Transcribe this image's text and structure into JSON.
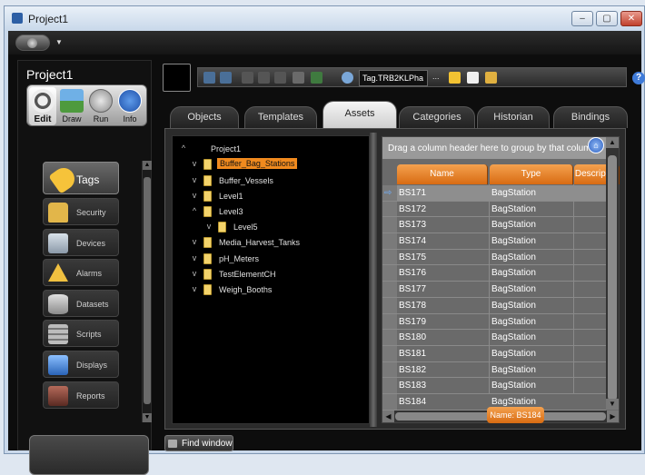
{
  "window": {
    "title": "Project1",
    "min_label": "–",
    "max_label": "▢",
    "close_label": "✕"
  },
  "project": {
    "title": "Project1"
  },
  "modes": [
    {
      "label": "Edit",
      "icon": "gear-icon"
    },
    {
      "label": "Draw",
      "icon": "picture-icon"
    },
    {
      "label": "Run",
      "icon": "play-icon"
    },
    {
      "label": "Info",
      "icon": "info-icon"
    }
  ],
  "nav": [
    {
      "label": "Tags",
      "icon": "tag-icon",
      "color": "#f6c33a"
    },
    {
      "label": "Security",
      "icon": "lock-icon",
      "color": "#e2b64a"
    },
    {
      "label": "Devices",
      "icon": "device-icon",
      "color": "#b9c4cf"
    },
    {
      "label": "Alarms",
      "icon": "warning-icon",
      "color": "#f0c040"
    },
    {
      "label": "Datasets",
      "icon": "database-icon",
      "color": "#c8c8c8"
    },
    {
      "label": "Scripts",
      "icon": "calculator-icon",
      "color": "#bcbcbc"
    },
    {
      "label": "Displays",
      "icon": "monitor-icon",
      "color": "#4a8ad8"
    },
    {
      "label": "Reports",
      "icon": "report-icon",
      "color": "#8a4a3a"
    }
  ],
  "toolbar": {
    "tag_field": "Tag.TRB2KLPha",
    "more_label": "...",
    "help_label": "?"
  },
  "tabs": [
    {
      "label": "Objects"
    },
    {
      "label": "Templates"
    },
    {
      "label": "Assets"
    },
    {
      "label": "Categories"
    },
    {
      "label": "Historian"
    },
    {
      "label": "Bindings"
    }
  ],
  "tree": {
    "root": {
      "label": "Project1",
      "expander": "^"
    },
    "items": [
      {
        "label": "Buffer_Bag_Stations",
        "expander": "v",
        "selected": true
      },
      {
        "label": "Buffer_Vessels",
        "expander": "v"
      },
      {
        "label": "Level1",
        "expander": "v"
      },
      {
        "label": "Level3",
        "expander": "^"
      },
      {
        "label": "Level5",
        "expander": "v"
      },
      {
        "label": "Media_Harvest_Tanks",
        "expander": "v"
      },
      {
        "label": "pH_Meters",
        "expander": "v"
      },
      {
        "label": "TestElementCH",
        "expander": "v"
      },
      {
        "label": "Weigh_Booths",
        "expander": "v"
      }
    ]
  },
  "grid": {
    "group_hint": "Drag a column header here to group by that column",
    "columns": [
      "Name",
      "Type",
      "Descripti..."
    ],
    "rows": [
      [
        "BS171",
        "BagStation",
        ""
      ],
      [
        "BS172",
        "BagStation",
        ""
      ],
      [
        "BS173",
        "BagStation",
        ""
      ],
      [
        "BS174",
        "BagStation",
        ""
      ],
      [
        "BS175",
        "BagStation",
        ""
      ],
      [
        "BS176",
        "BagStation",
        ""
      ],
      [
        "BS177",
        "BagStation",
        ""
      ],
      [
        "BS178",
        "BagStation",
        ""
      ],
      [
        "BS179",
        "BagStation",
        ""
      ],
      [
        "BS180",
        "BagStation",
        ""
      ],
      [
        "BS181",
        "BagStation",
        ""
      ],
      [
        "BS182",
        "BagStation",
        ""
      ],
      [
        "BS183",
        "BagStation",
        ""
      ],
      [
        "BS184",
        "BagStation",
        ""
      ]
    ],
    "tooltip": "Name: BS184",
    "current_row_marker": "⇨"
  },
  "find_window": {
    "label": "Find window"
  }
}
